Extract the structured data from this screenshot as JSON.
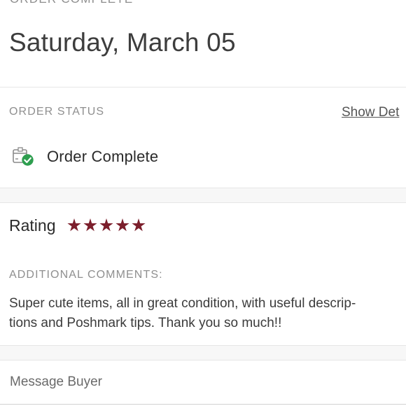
{
  "header": {
    "cut_label": "ORDER COMPLETE",
    "date": "Saturday, March 05"
  },
  "order_status": {
    "label": "ORDER STATUS",
    "details_link": "Show Det",
    "status_text": "Order Complete",
    "status_icon": "package-check-icon",
    "status_color": "#2e9e4f"
  },
  "rating": {
    "label": "Rating",
    "stars": 5,
    "max_stars": 5,
    "star_color": "#7c1f2c"
  },
  "comments": {
    "label": "ADDITIONAL COMMENTS:",
    "lines": [
      "Super cute items, all in great condition, with useful descrip-",
      "tions and Poshmark tips. Thank you so much!!"
    ]
  },
  "actions": {
    "message_buyer": "Message Buyer"
  }
}
